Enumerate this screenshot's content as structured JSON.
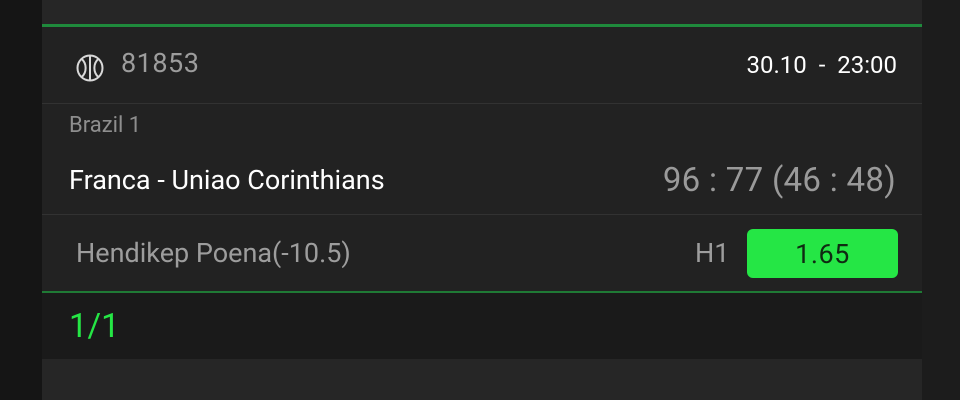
{
  "ticket": {
    "sport_icon": "basketball-icon",
    "match_id": "81853",
    "datetime": "30.10  -  23:00",
    "league": "Brazil 1",
    "teams": "Franca - Uniao Corinthians",
    "score": "96 : 77 (46 : 48)",
    "market": "Hendikep Poena(-10.5)",
    "pick": "H1",
    "odds": "1.65"
  },
  "footer": {
    "count": "1/1"
  },
  "colors": {
    "accent_green": "#25e645",
    "divider_green": "#1f8a3c",
    "card_bg": "#222222"
  }
}
